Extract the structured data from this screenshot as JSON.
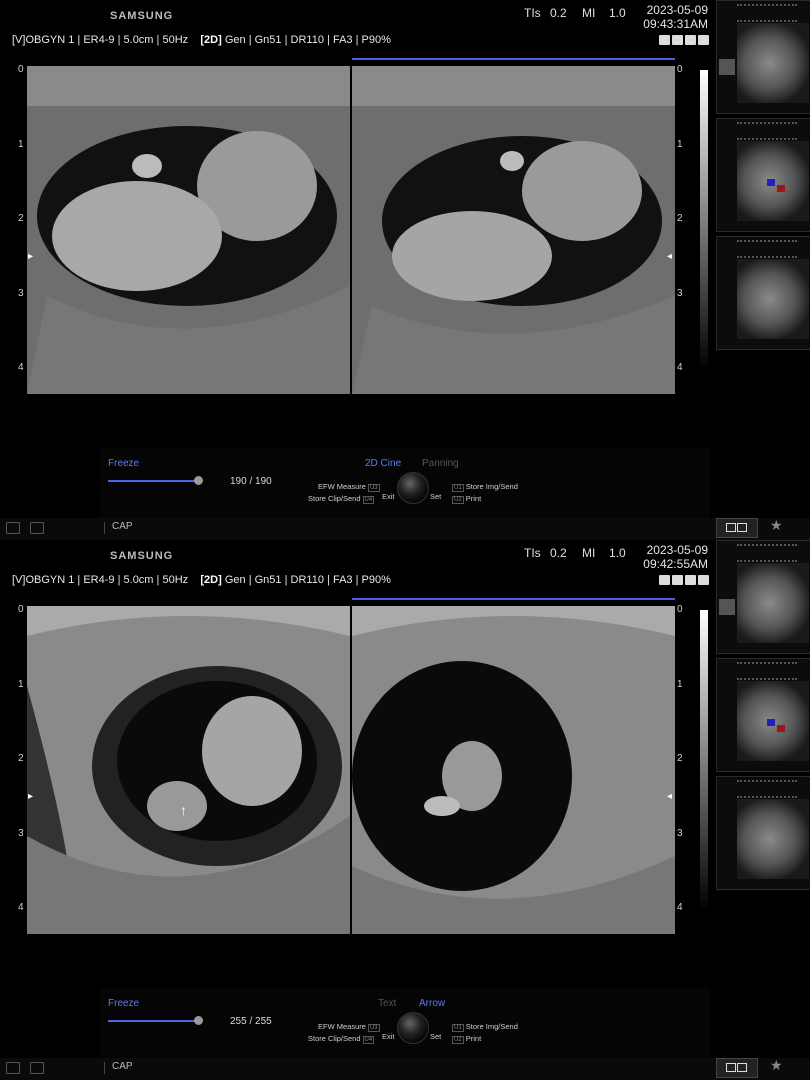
{
  "screens": [
    {
      "brand": "SAMSUNG",
      "tis_label": "TIs",
      "tis_value": "0.2",
      "mi_label": "MI",
      "mi_value": "1.0",
      "date": "2023-05-09",
      "time": "09:43:31AM",
      "probe": "[V]OBGYN 1",
      "transducer": "ER4-9",
      "depth": "5.0cm",
      "frame_rate": "50Hz",
      "mode": "[2D]",
      "gain": "Gen",
      "gn": "Gn51",
      "dr": "DR110",
      "fa": "FA3",
      "power": "P90%",
      "s_marker": "S",
      "depth_scale": [
        "0",
        "1",
        "2",
        "3",
        "4"
      ],
      "freeze_label": "Freeze",
      "frame_counter": "190 / 190",
      "frame_progress": 1.0,
      "mode_tab_active": "2D Cine",
      "mode_tab_inactive": "Panning",
      "efw_measure": "EFW Measure",
      "efw_key": "U3",
      "store_clip": "Store Clip/Send",
      "store_clip_key": "U4",
      "exit_label": "Exit",
      "set_label": "Set",
      "store_img": "Store Img/Send",
      "store_img_key": "U1",
      "print_label": "Print",
      "print_key": "U2",
      "cap_label": "CAP",
      "star_glyph": "★"
    },
    {
      "brand": "SAMSUNG",
      "tis_label": "TIs",
      "tis_value": "0.2",
      "mi_label": "MI",
      "mi_value": "1.0",
      "date": "2023-05-09",
      "time": "09:42:55AM",
      "probe": "[V]OBGYN 1",
      "transducer": "ER4-9",
      "depth": "5.0cm",
      "frame_rate": "50Hz",
      "mode": "[2D]",
      "gain": "Gen",
      "gn": "Gn51",
      "dr": "DR110",
      "fa": "FA3",
      "power": "P90%",
      "s_marker": "S",
      "depth_scale": [
        "0",
        "1",
        "2",
        "3",
        "4"
      ],
      "freeze_label": "Freeze",
      "frame_counter": "255 / 255",
      "frame_progress": 1.0,
      "mode_tab_inactive": "Text",
      "mode_tab_active": "Arrow",
      "efw_measure": "EFW Measure",
      "efw_key": "U3",
      "store_clip": "Store Clip/Send",
      "store_clip_key": "U4",
      "exit_label": "Exit",
      "set_label": "Set",
      "store_img": "Store Img/Send",
      "store_img_key": "U1",
      "print_label": "Print",
      "print_key": "U2",
      "cap_label": "CAP",
      "star_glyph": "★",
      "arrow_glyph": "↑"
    }
  ],
  "colors": {
    "accent": "#4b6ae0",
    "active_text": "#5b7cf0",
    "inactive_text": "#555555"
  }
}
